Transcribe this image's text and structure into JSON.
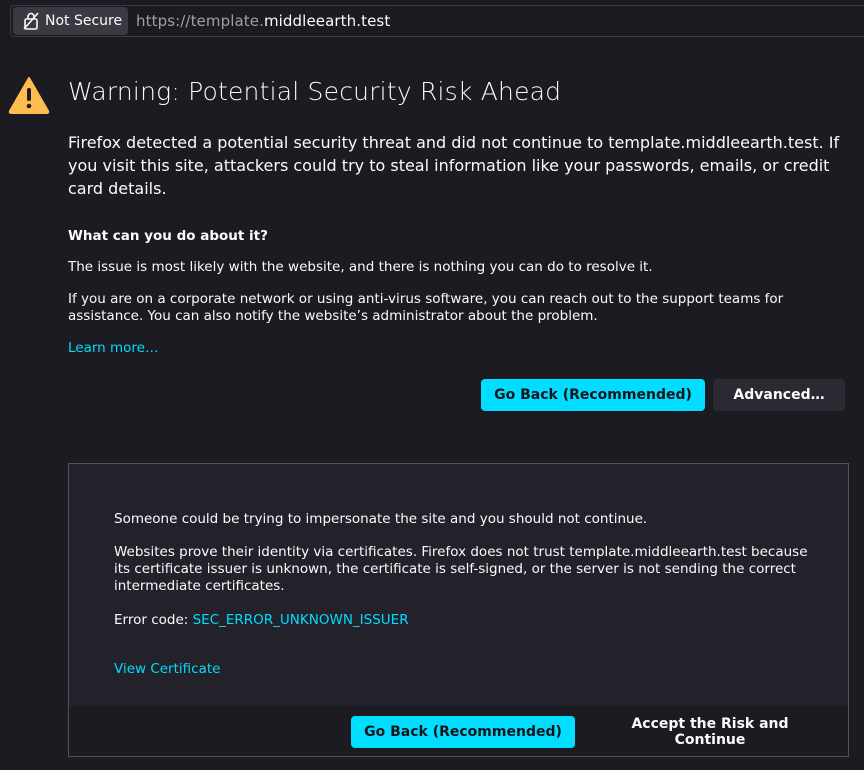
{
  "urlbar": {
    "security_label": "Not Secure",
    "url_scheme": "https://template.",
    "url_host": "middleearth.test"
  },
  "page": {
    "title": "Warning: Potential Security Risk Ahead",
    "intro": "Firefox detected a potential security threat and did not continue to template.middleearth.test. If you visit this site, attackers could try to steal information like your passwords, emails, or credit card details.",
    "subheading": "What can you do about it?",
    "para1": "The issue is most likely with the website, and there is nothing you can do to resolve it.",
    "para2": "If you are on a corporate network or using anti-virus software, you can reach out to the support teams for assistance. You can also notify the website’s administrator about the problem.",
    "learn_more": "Learn more…",
    "go_back_label": "Go Back (Recommended)",
    "advanced_label": "Advanced…"
  },
  "advanced_panel": {
    "line1": "Someone could be trying to impersonate the site and you should not continue.",
    "line2": "Websites prove their identity via certificates. Firefox does not trust template.middleearth.test because its certificate issuer is unknown, the certificate is self-signed, or the server is not sending the correct intermediate certificates.",
    "error_prefix": "Error code: ",
    "error_code": "SEC_ERROR_UNKNOWN_ISSUER",
    "view_certificate": "View Certificate",
    "go_back_label": "Go Back (Recommended)",
    "accept_label": "Accept the Risk and Continue"
  },
  "colors": {
    "background": "#1c1b22",
    "accent": "#00ddff",
    "warning": "#ffbd4f"
  }
}
